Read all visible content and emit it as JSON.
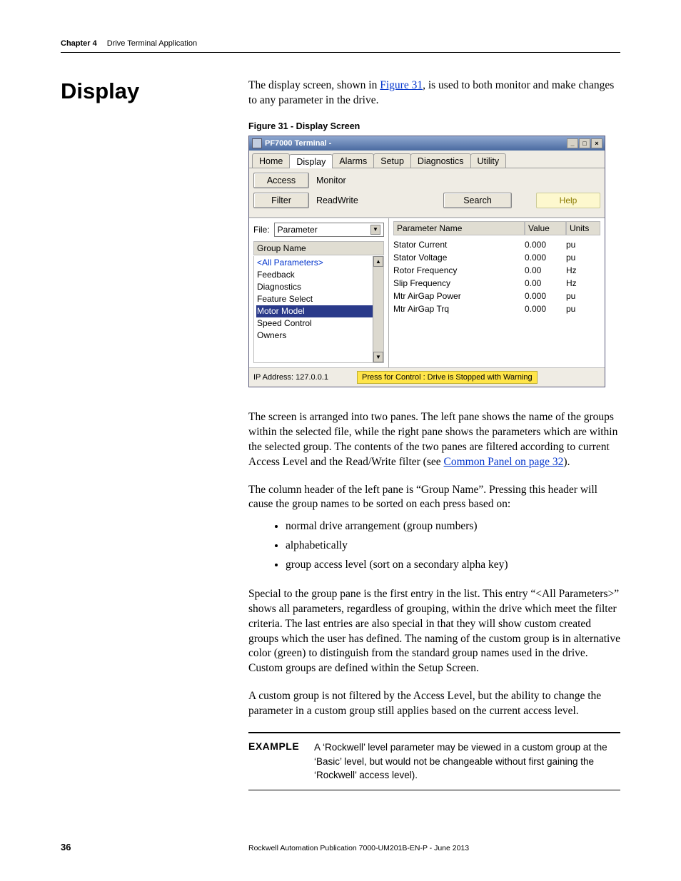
{
  "header": {
    "chapter": "Chapter 4",
    "title": "Drive Terminal Application"
  },
  "heading": "Display",
  "intro": {
    "pre": "The display screen, shown in ",
    "link": "Figure 31",
    "post": ", is used to both monitor and make changes to any parameter in the drive."
  },
  "figure": {
    "caption": "Figure 31 - Display Screen",
    "window_title": "PF7000 Terminal -",
    "tabs": [
      "Home",
      "Display",
      "Alarms",
      "Setup",
      "Diagnostics",
      "Utility"
    ],
    "toolbar": {
      "access": "Access",
      "monitor": "Monitor",
      "filter": "Filter",
      "readwrite": "ReadWrite",
      "search": "Search",
      "help": "Help"
    },
    "left_pane": {
      "file_label": "File:",
      "file_value": "Parameter",
      "group_header": "Group Name",
      "groups": [
        {
          "label": "<All Parameters>",
          "blue": true
        },
        {
          "label": "Feedback"
        },
        {
          "label": "Diagnostics"
        },
        {
          "label": "Feature Select"
        },
        {
          "label": "Motor Model",
          "selected": true
        },
        {
          "label": "Speed Control"
        },
        {
          "label": "Owners"
        }
      ]
    },
    "right_pane": {
      "headers": {
        "name": "Parameter Name",
        "value": "Value",
        "units": "Units"
      },
      "rows": [
        {
          "name": "Stator Current",
          "value": "0.000",
          "units": "pu"
        },
        {
          "name": "Stator Voltage",
          "value": "0.000",
          "units": "pu"
        },
        {
          "name": "Rotor Frequency",
          "value": "0.00",
          "units": "Hz"
        },
        {
          "name": "Slip Frequency",
          "value": "0.00",
          "units": "Hz"
        },
        {
          "name": "Mtr AirGap Power",
          "value": "0.000",
          "units": "pu"
        },
        {
          "name": "Mtr AirGap Trq",
          "value": "0.000",
          "units": "pu"
        }
      ]
    },
    "status": {
      "ip": "IP Address: 127.0.0.1",
      "msg": "Press for Control : Drive is Stopped with Warning"
    }
  },
  "para2": {
    "pre": "The screen is arranged into two panes. The left pane shows the name of the groups within the selected file, while the right pane shows the parameters which are within the selected group. The contents of the two panes are filtered according to current Access Level and the Read/Write filter (see ",
    "link": "Common Panel on page 32",
    "post": ")."
  },
  "para3": "The column header of the left pane is “Group Name”. Pressing this header will cause the group names to be sorted on each press based on:",
  "sort_list": [
    "normal drive arrangement (group numbers)",
    "alphabetically",
    "group access level (sort on a secondary alpha key)"
  ],
  "para4": "Special to the group pane is the first entry in the list. This entry “<All Parameters>” shows all parameters, regardless of grouping, within the drive which meet the filter criteria. The last entries are also special in that they will show custom created groups which the user has defined. The naming of the custom group is in alternative color (green) to distinguish from the standard group names used in the drive. Custom groups are defined within the Setup Screen.",
  "para5": "A custom group is not filtered by the Access Level, but the ability to change the parameter in a custom group still applies based on the current access level.",
  "example": {
    "label": "EXAMPLE",
    "text": "A ‘Rockwell’ level parameter may be viewed in a custom group at the ‘Basic’ level, but would not be changeable without first gaining the ‘Rockwell’ access level)."
  },
  "footer": {
    "page": "36",
    "pub": "Rockwell Automation Publication 7000-UM201B-EN-P - June 2013"
  }
}
